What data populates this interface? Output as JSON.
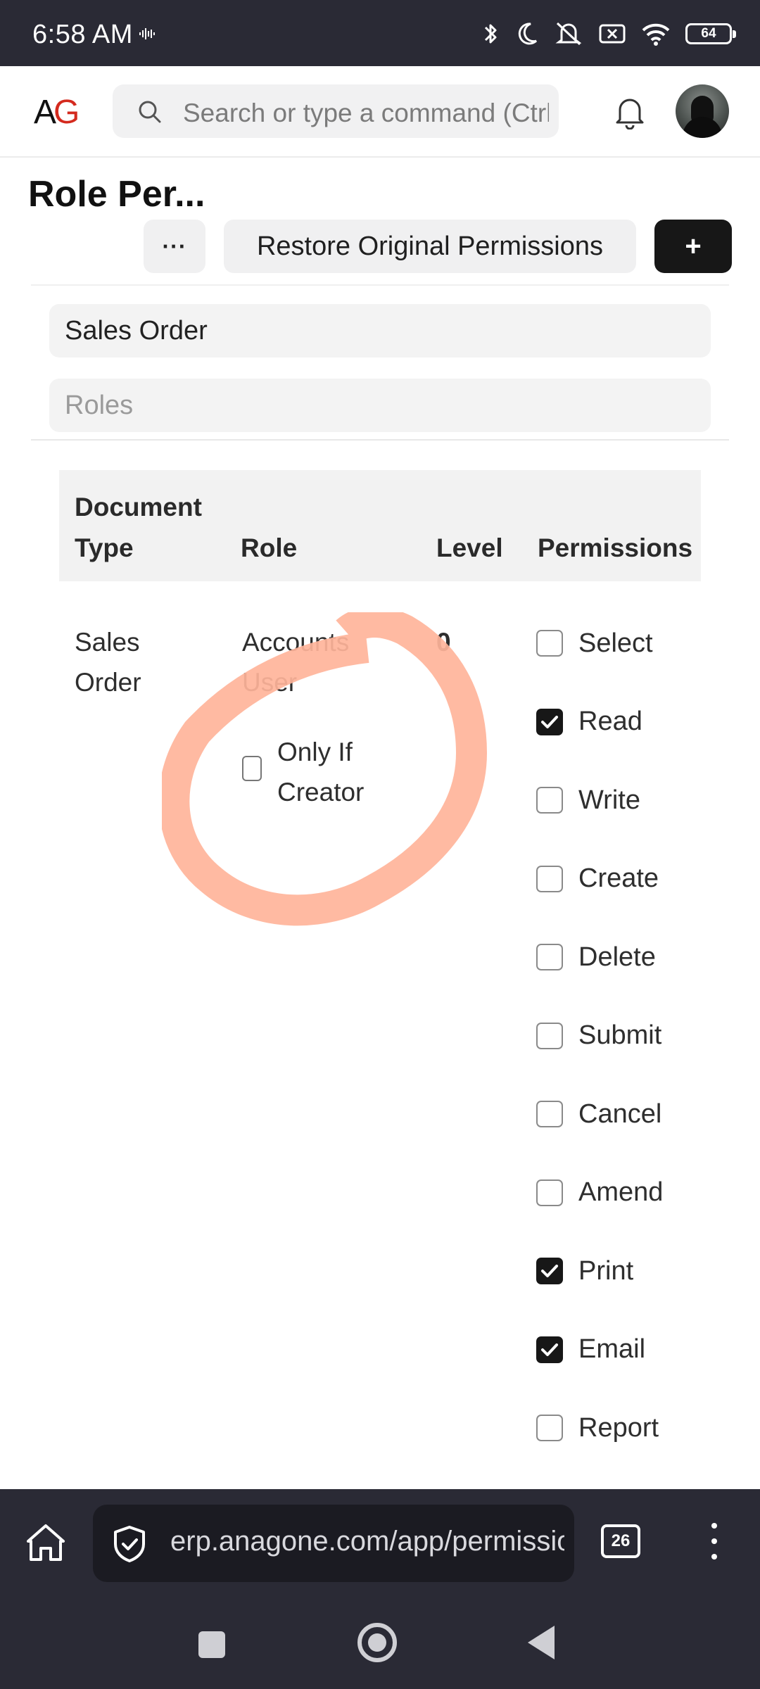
{
  "status_bar": {
    "time": "6:58 AM",
    "battery": "64",
    "icons": [
      "wave-icon",
      "bluetooth-icon",
      "moon-icon",
      "mute-icon",
      "x-box-icon",
      "wifi-icon",
      "battery-icon"
    ]
  },
  "header": {
    "logo_a": "A",
    "logo_g": "G",
    "search_placeholder": "Search or type a command (Ctrl + G)",
    "colors": {
      "logo_g": "#d42a1e"
    }
  },
  "page": {
    "title": "Role Per...",
    "more_label": "···",
    "restore_label": "Restore Original Permissions",
    "add_label": "+"
  },
  "filters": {
    "doctype_value": "Sales Order",
    "roles_placeholder": "Roles"
  },
  "table": {
    "headers": {
      "document_type": "Document Type",
      "role": "Role",
      "level": "Level",
      "permissions": "Permissions"
    },
    "row": {
      "document_type": "Sales Order",
      "role": "Accounts User",
      "level": "0",
      "only_if_creator_label": "Only If Creator",
      "only_if_creator_checked": false,
      "permissions": [
        {
          "label": "Select",
          "checked": false
        },
        {
          "label": "Read",
          "checked": true
        },
        {
          "label": "Write",
          "checked": false
        },
        {
          "label": "Create",
          "checked": false
        },
        {
          "label": "Delete",
          "checked": false
        },
        {
          "label": "Submit",
          "checked": false
        },
        {
          "label": "Cancel",
          "checked": false
        },
        {
          "label": "Amend",
          "checked": false
        },
        {
          "label": "Print",
          "checked": true
        },
        {
          "label": "Email",
          "checked": true
        },
        {
          "label": "Report",
          "checked": false
        }
      ]
    }
  },
  "annotation": {
    "color": "#ffb49a"
  },
  "browser": {
    "url": "erp.anagone.com/app/permission-manager",
    "tab_count": "26"
  }
}
